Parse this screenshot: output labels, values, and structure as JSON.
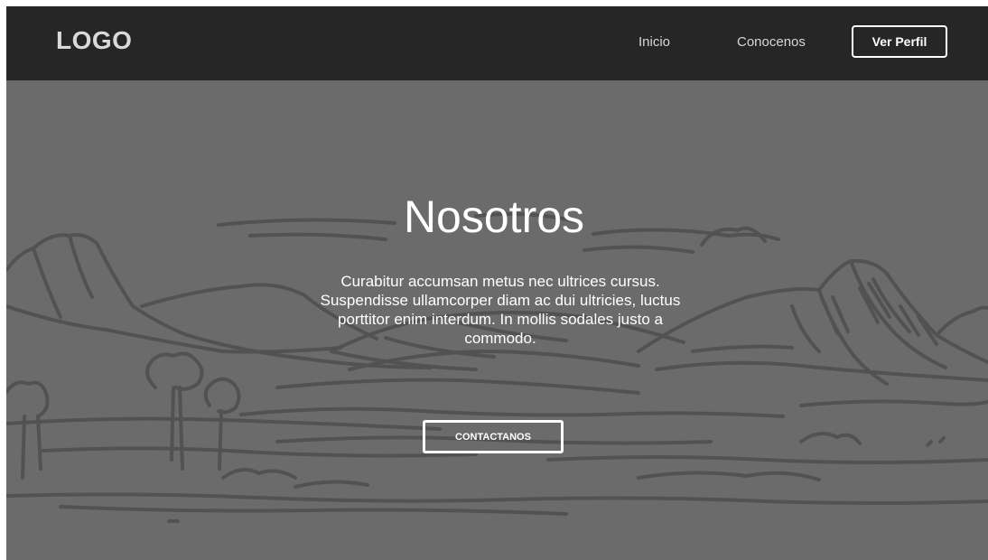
{
  "navbar": {
    "logo": "LOGO",
    "links": [
      {
        "label": "Inicio"
      },
      {
        "label": "Conocenos"
      }
    ],
    "cta_label": "Ver Perfil"
  },
  "hero": {
    "title": "Nosotros",
    "description": "Curabitur accumsan metus nec ultrices cursus. Suspendisse ullamcorper diam ac dui ultricies, luctus porttitor enim interdum. In mollis sodales justo a commodo.",
    "button_label": "CONTACTANOS",
    "background": "mountain-landscape-sketch"
  },
  "colors": {
    "navbar_bg": "#262626",
    "hero_bg": "#6b6b6b",
    "sketch_lines": "#525252",
    "text": "#ffffff"
  }
}
